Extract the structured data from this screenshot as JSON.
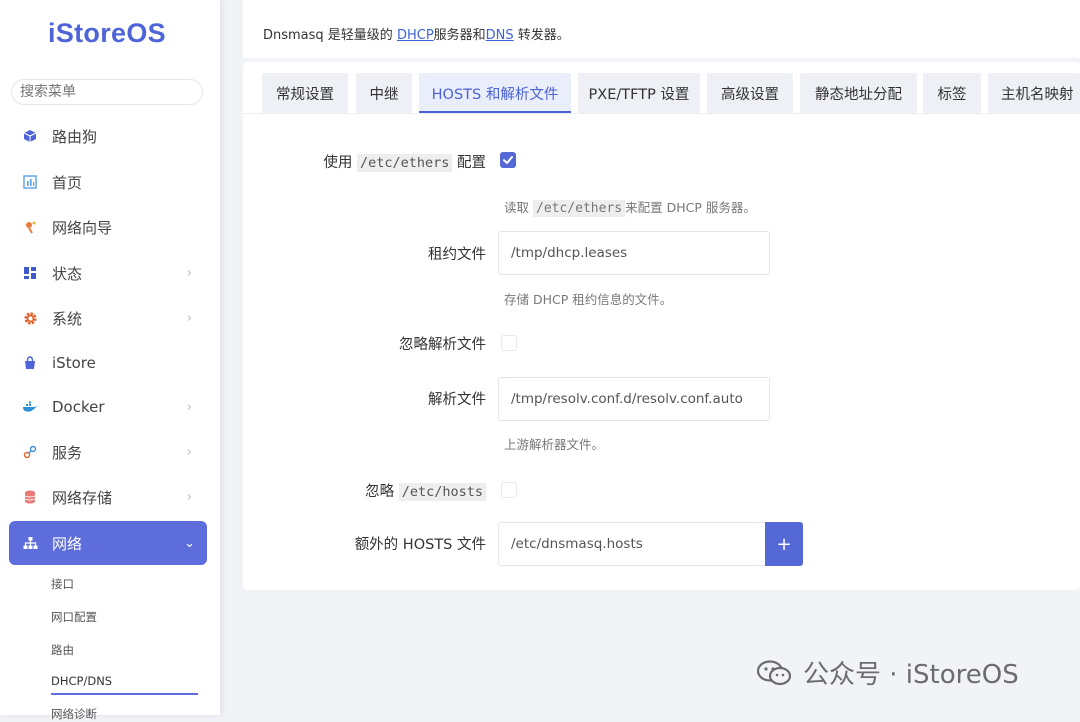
{
  "app": {
    "logo": "iStoreOS"
  },
  "sidebar": {
    "search_placeholder": "搜索菜单",
    "items": [
      {
        "label": "路由狗",
        "icon": "cube-icon"
      },
      {
        "label": "首页",
        "icon": "dashboard-icon"
      },
      {
        "label": "网络向导",
        "icon": "wizard-icon"
      },
      {
        "label": "状态",
        "icon": "grid-icon"
      },
      {
        "label": "系统",
        "icon": "gear-icon"
      },
      {
        "label": "iStore",
        "icon": "store-icon"
      },
      {
        "label": "Docker",
        "icon": "docker-icon"
      },
      {
        "label": "服务",
        "icon": "services-icon"
      },
      {
        "label": "网络存储",
        "icon": "storage-icon"
      },
      {
        "label": "网络",
        "icon": "network-icon"
      }
    ],
    "sub_items": [
      "接口",
      "网口配置",
      "路由",
      "DHCP/DNS",
      "网络诊断"
    ]
  },
  "header": {
    "desc_prefix": "Dnsmasq 是轻量级的 ",
    "desc_link1": "DHCP",
    "desc_mid": "服务器和",
    "desc_link2": "DNS",
    "desc_suffix": " 转发器。"
  },
  "tabs": [
    "常规设置",
    "中继",
    "HOSTS 和解析文件",
    "PXE/TFTP 设置",
    "高级设置",
    "静态地址分配",
    "标签",
    "主机名映射"
  ],
  "form": {
    "ethers_label_pre": "使用",
    "ethers_code": "/etc/ethers",
    "ethers_label_post": "配置",
    "ethers_checked": true,
    "ethers_help_pre": "读取",
    "ethers_help_code": "/etc/ethers",
    "ethers_help_post": "来配置 DHCP 服务器。",
    "lease_label": "租约文件",
    "lease_value": "/tmp/dhcp.leases",
    "lease_help": "存储 DHCP 租约信息的文件。",
    "ignore_resolv_label": "忽略解析文件",
    "ignore_resolv_checked": false,
    "resolv_label": "解析文件",
    "resolv_value": "/tmp/resolv.conf.d/resolv.conf.auto",
    "resolv_help": "上游解析器文件。",
    "ignore_hosts_label": "忽略",
    "ignore_hosts_code": "/etc/hosts",
    "ignore_hosts_checked": false,
    "extra_hosts_label": "额外的 HOSTS 文件",
    "extra_hosts_value": "/etc/dnsmasq.hosts",
    "add_label": "+"
  },
  "watermark": {
    "text": "公众号 · iStoreOS"
  },
  "colors": {
    "accent": "#5468d6",
    "link": "#3f63d6"
  }
}
